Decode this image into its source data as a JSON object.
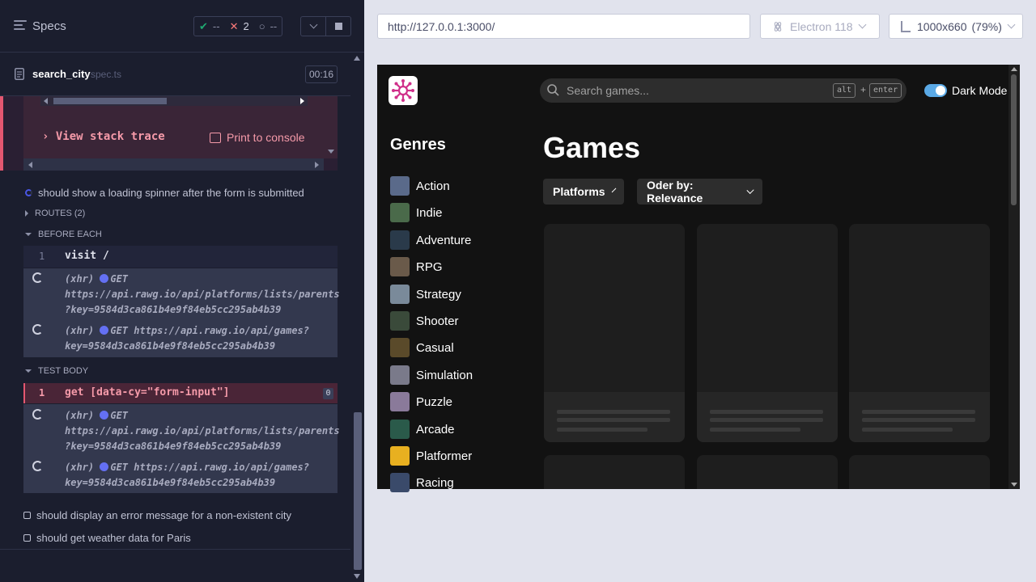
{
  "header": {
    "title": "Specs",
    "stats": {
      "passed": "--",
      "failed": "2",
      "pending": "--"
    }
  },
  "spec_file": {
    "name": "search_city",
    "ext": "spec.ts",
    "duration": "00:16"
  },
  "error": {
    "stack_trace_label": "View stack trace",
    "print_label": "Print to console"
  },
  "tests": {
    "current": "should show a loading spinner after the form is submitted",
    "pending_1": "should display an error message for a non-existent city",
    "pending_2": "should get weather data for Paris"
  },
  "sections": {
    "routes": "ROUTES (2)",
    "before_each": "BEFORE EACH",
    "test_body": "TEST BODY"
  },
  "before_each": {
    "cmd_num": "1",
    "cmd": "visit  /",
    "xhr1_l1": "(xhr)",
    "xhr1_method": "GET",
    "xhr1_l2": "https://api.rawg.io/api/platforms/lists/parents",
    "xhr1_l3": "?key=9584d3ca861b4e9f84eb5cc295ab4b39",
    "xhr2_l1": "(xhr)",
    "xhr2_method": "GET https://api.rawg.io/api/games?",
    "xhr2_l2": "key=9584d3ca861b4e9f84eb5cc295ab4b39"
  },
  "test_body": {
    "cmd_num": "1",
    "cmd": "get  [data-cy=\"form-input\"]",
    "badge": "0",
    "xhr1_l1": "(xhr)",
    "xhr1_method": "GET",
    "xhr1_l2": "https://api.rawg.io/api/platforms/lists/parents",
    "xhr1_l3": "?key=9584d3ca861b4e9f84eb5cc295ab4b39",
    "xhr2_l1": "(xhr)",
    "xhr2_method": "GET https://api.rawg.io/api/games?",
    "xhr2_l2": "key=9584d3ca861b4e9f84eb5cc295ab4b39"
  },
  "toolbar": {
    "url": "http://127.0.0.1:3000/",
    "browser": "Electron 118",
    "viewport": "1000x660",
    "zoom": "(79%)"
  },
  "app": {
    "search_placeholder": "Search games...",
    "kbd_alt": "alt",
    "kbd_plus": "+",
    "kbd_enter": "enter",
    "dark_mode_label": "Dark Mode",
    "dark_mode_on": true,
    "genres_heading": "Genres",
    "genres": [
      "Action",
      "Indie",
      "Adventure",
      "RPG",
      "Strategy",
      "Shooter",
      "Casual",
      "Simulation",
      "Puzzle",
      "Arcade",
      "Platformer",
      "Racing"
    ],
    "games_heading": "Games",
    "platforms_label": "Platforms",
    "order_label": "Oder by: Relevance"
  }
}
